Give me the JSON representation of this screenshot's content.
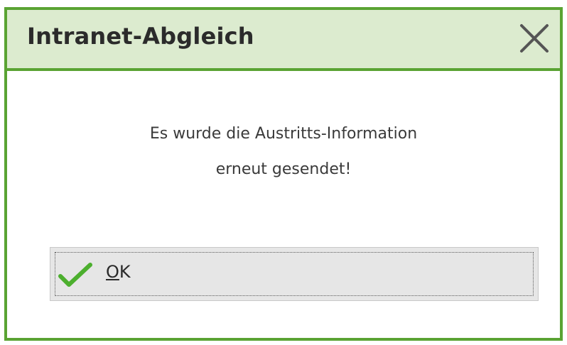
{
  "dialog": {
    "title": "Intranet-Abgleich",
    "close_icon": "close-icon",
    "message_lines": [
      "Es wurde die Austritts-Information",
      "erneut gesendet!"
    ],
    "ok_button": {
      "mnemonic": "O",
      "label_rest": "K",
      "icon": "checkmark-icon"
    }
  },
  "colors": {
    "frame": "#5aa333",
    "titlebar_bg": "#dcebcf",
    "checkmark": "#4caf2e",
    "button_bg": "#e6e6e6"
  }
}
